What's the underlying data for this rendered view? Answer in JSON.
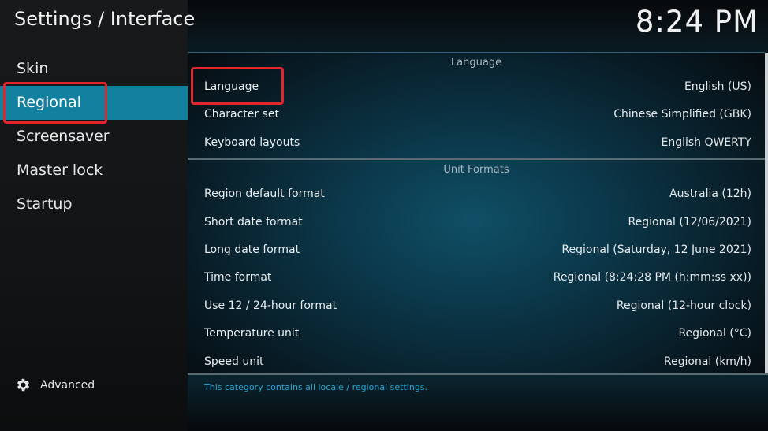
{
  "header": {
    "title": "Settings / Interface",
    "clock": "8:24 PM"
  },
  "sidebar": {
    "items": [
      {
        "label": "Skin"
      },
      {
        "label": "Regional"
      },
      {
        "label": "Screensaver"
      },
      {
        "label": "Master lock"
      },
      {
        "label": "Startup"
      }
    ],
    "active_index": 1,
    "advanced_label": "Advanced",
    "advanced_icon": "gear-icon"
  },
  "sections": [
    {
      "header": "Language",
      "rows": [
        {
          "label": "Language",
          "value": "English (US)"
        },
        {
          "label": "Character set",
          "value": "Chinese Simplified (GBK)"
        },
        {
          "label": "Keyboard layouts",
          "value": "English QWERTY"
        }
      ]
    },
    {
      "header": "Unit Formats",
      "rows": [
        {
          "label": "Region default format",
          "value": "Australia (12h)"
        },
        {
          "label": "Short date format",
          "value": "Regional (12/06/2021)"
        },
        {
          "label": "Long date format",
          "value": "Regional (Saturday, 12 June 2021)"
        },
        {
          "label": "Time format",
          "value": "Regional (8:24:28 PM (h:mm:ss xx))"
        },
        {
          "label": "Use 12 / 24-hour format",
          "value": "Regional (12-hour clock)"
        },
        {
          "label": "Temperature unit",
          "value": "Regional (°C)"
        },
        {
          "label": "Speed unit",
          "value": "Regional (km/h)"
        }
      ]
    }
  ],
  "footer": {
    "description": "This category contains all locale / regional settings."
  },
  "colors": {
    "accent": "#12809f",
    "highlight_box": "#e3262b",
    "footer_text": "#2ba7d6"
  }
}
